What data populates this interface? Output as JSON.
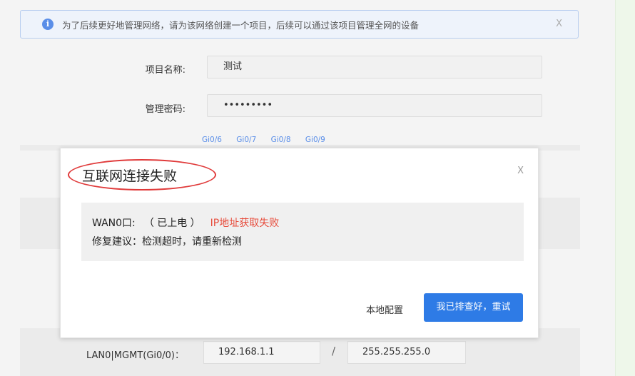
{
  "notice": {
    "text": "为了后续更好地管理网络，请为该网络创建一个项目，后续可以通过该项目管理全网的设备",
    "close": "X"
  },
  "form": {
    "project_name_label": "项目名称:",
    "project_name_value": "测试",
    "password_label": "管理密码:",
    "password_value": "•••••••••"
  },
  "ports": [
    "Gi0/6",
    "Gi0/7",
    "Gi0/8",
    "Gi0/9"
  ],
  "lan": {
    "label": "LAN0|MGMT(Gi0/0)：",
    "ip": "192.168.1.1",
    "separator": "/",
    "mask": "255.255.255.0"
  },
  "modal": {
    "title": "互联网连接失败",
    "close": "X",
    "wan_label": "WAN0口:",
    "power_status": "（ 已上电 ）",
    "error": "IP地址获取失败",
    "suggestion": "修复建议：检测超时，请重新检测",
    "local_config": "本地配置",
    "retry": "我已排查好，重试"
  },
  "colors": {
    "accent": "#2e7be6",
    "error": "#e74c3c",
    "highlight_ring": "#e03a3a"
  }
}
